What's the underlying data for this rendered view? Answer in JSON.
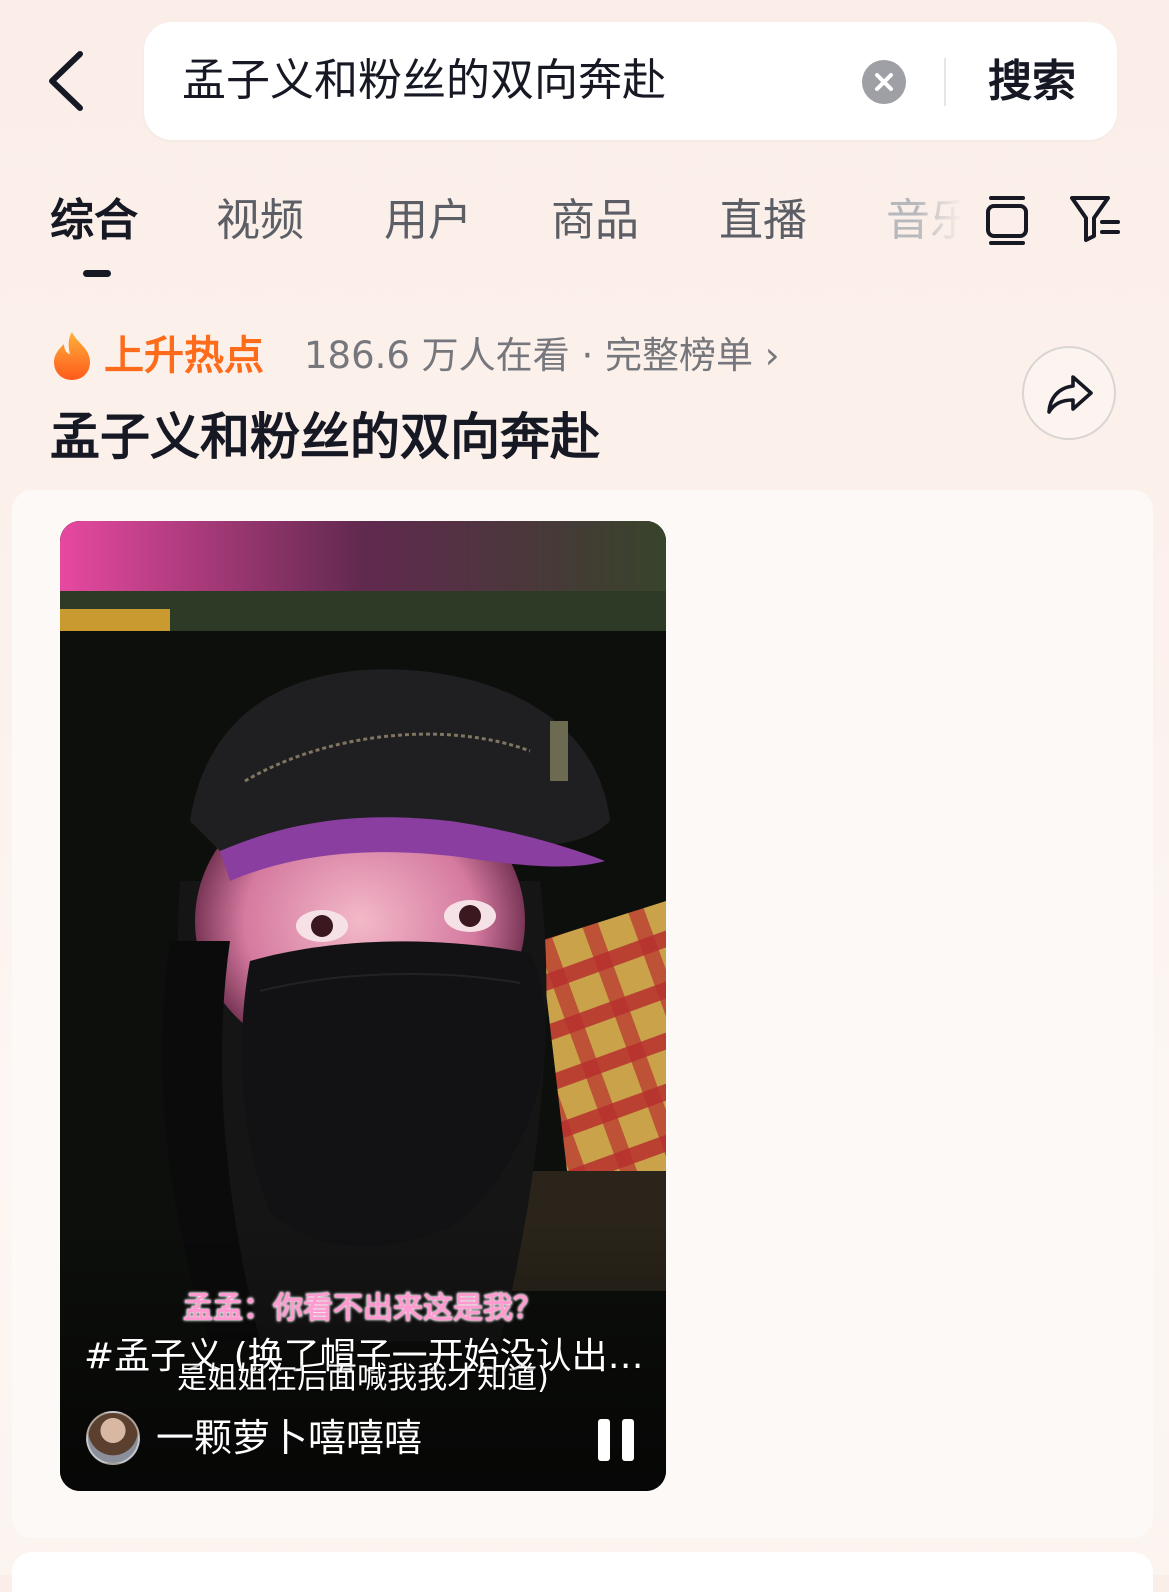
{
  "search": {
    "query": "孟子义和粉丝的双向奔赴",
    "submit_label": "搜索"
  },
  "tabs": [
    {
      "label": "综合",
      "active": true
    },
    {
      "label": "视频",
      "active": false
    },
    {
      "label": "用户",
      "active": false
    },
    {
      "label": "商品",
      "active": false
    },
    {
      "label": "直播",
      "active": false
    },
    {
      "label": "音乐",
      "active": false
    }
  ],
  "hot": {
    "badge_label": "上升热点",
    "meta": "186.6 万人在看 · 完整榜单 ›",
    "title": "孟子义和粉丝的双向奔赴"
  },
  "video": {
    "caption_pink": "孟孟：你看不出来这是我？",
    "description": "#孟子义 (换了帽子一开始没认出来姐…",
    "caption_white": "是姐姐在后面喊我我才知道)",
    "author": "一颗萝卜嘻嘻嘻"
  },
  "colors": {
    "accent_hot": "#fe6c1b",
    "text_primary": "#161823",
    "text_secondary": "#75777d",
    "caption_pink": "#ff9bd0"
  },
  "icons": {
    "back": "chevron-left-icon",
    "clear": "clear-circle-icon",
    "layout": "card-layout-icon",
    "filter": "filter-icon",
    "fire": "fire-icon",
    "share": "share-icon",
    "pause": "pause-icon"
  }
}
